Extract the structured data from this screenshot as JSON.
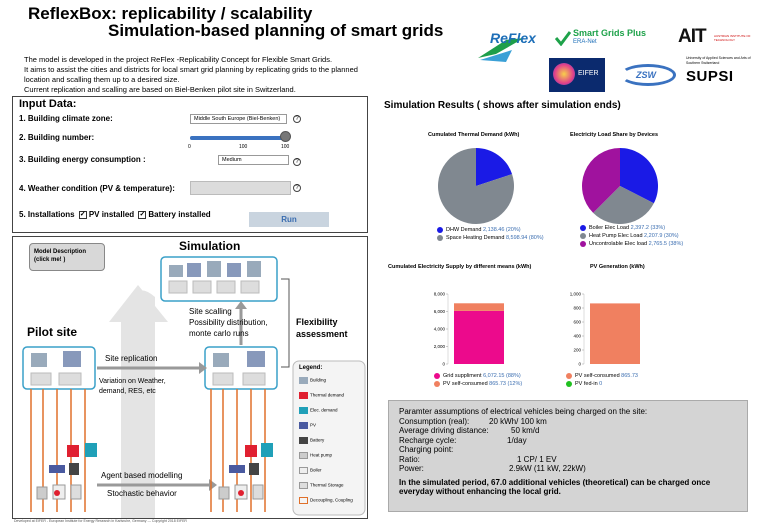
{
  "header": {
    "title": "ReflexBox: replicability / scalability",
    "subtitle": "Simulation-based planning of smart grids",
    "lines": [
      "The model is developed in the project ReFlex -Replicability Concept for Flexible Smart Grids.",
      "It aims to assist the cities and districts for local smart grid planning by replicating grids to the planned",
      "location and scalling them up to a desired size.",
      "Current replication and scalling are based on Biel-Benken pilot site in Switzerland."
    ],
    "logos": {
      "reflex": "ReFlex",
      "sgp_main": "Smart Grids Plus",
      "sgp_sub": "ERA-Net",
      "ait": "AIT",
      "ait_sub": "AUSTRIAN INSTITUTE OF TECHNOLOGY",
      "eifer": "EIFER",
      "zsw": "ZSW",
      "supsi_sub": "University of Applied Sciences and Arts of Southern Switzerland",
      "supsi": "SUPSI"
    }
  },
  "input": {
    "title": "Input Data:",
    "climate_label": "1. Building climate zone:",
    "climate_value": "Middle South Europe (Biel-Benken)",
    "number_label": "2. Building number:",
    "slider_ticks": [
      "0",
      "100",
      "100"
    ],
    "consumption_label": "3. Building energy consumption :",
    "consumption_value": "Medium",
    "weather_label": "4. Weather condition (PV & temperature):",
    "installations_label": "5. Installations",
    "pv_label": "PV installed",
    "battery_label": "Battery installed",
    "run_label": "Run",
    "help_symbol": "?",
    "check_symbol": "✓",
    "slider_level": 0.95
  },
  "diagram": {
    "model_button": "Model Description (click me! )",
    "simulation": "Simulation",
    "pilot_site": "Pilot site",
    "site_scalling": "Site scalling",
    "possibility": "Possibility distribution,",
    "montecarlo": "monte carlo runs",
    "flex1": "Flexibility",
    "flex2": "assessment",
    "site_replication": "Site replication",
    "variation1": "Variation on Weather,",
    "variation2": "demand, RES, etc",
    "agent": "Agent based modelling",
    "stochastic": "Stochastic behavior",
    "legend_title": "Legend:",
    "legend_items": [
      "Building",
      "Thermal demand",
      "Elec. demand",
      "PV",
      "Battery",
      "Heat pump",
      "Boiler",
      "Thermal Storage",
      "Decoupling, Coupling"
    ]
  },
  "results": {
    "title": "Simulation Results ( shows after simulation ends)",
    "thermal_title": "Cumulated Thermal Demand (kWh)",
    "thermal_legend": [
      {
        "name": "DHW Demand",
        "value": "2,138.46 (20%)",
        "color": "#1a1ae6"
      },
      {
        "name": "Space Heating Demand",
        "value": "8,598.94 (80%)",
        "color": "#808890"
      }
    ],
    "elec_title": "Electricity Load Share by Devices",
    "elec_legend": [
      {
        "name": "Boiler Elec Load",
        "value": "2,397.2 (33%)",
        "color": "#1a1ae6"
      },
      {
        "name": "Heat Pump Elec Load",
        "value": "2,207.9 (30%)",
        "color": "#808890"
      },
      {
        "name": "Uncontrolable Elec load",
        "value": "2,765.5 (38%)",
        "color": "#a0129e"
      }
    ],
    "supply_title": "Cumulated Electricity Supply by different means (kWh)",
    "supply_legend": [
      {
        "name": "Grid suppliment",
        "value": "6,072.15 (88%)",
        "color": "#ec0a8c"
      },
      {
        "name": "PV self-consumed",
        "value": "865.73 (12%)",
        "color": "#f08060"
      }
    ],
    "pv_title": "PV Generation (kWh)",
    "pv_legend": [
      {
        "name": "PV self-consumed",
        "value": "865.73",
        "color": "#f08060"
      },
      {
        "name": "PV fed-in",
        "value": "0",
        "color": "#20c020"
      }
    ]
  },
  "chart_data": [
    {
      "type": "pie",
      "title": "Cumulated Thermal Demand (kWh)",
      "labels": [
        "DHW Demand",
        "Space Heating Demand"
      ],
      "values": [
        2138.46,
        8598.94
      ],
      "colors": [
        "#1a1ae6",
        "#808890"
      ]
    },
    {
      "type": "pie",
      "title": "Electricity Load Share by Devices",
      "labels": [
        "Boiler Elec Load",
        "Heat Pump Elec Load",
        "Uncontrolable Elec load"
      ],
      "values": [
        2397.2,
        2207.9,
        2765.5
      ],
      "colors": [
        "#1a1ae6",
        "#808890",
        "#a0129e"
      ]
    },
    {
      "type": "bar",
      "title": "Cumulated Electricity Supply by different means (kWh)",
      "categories": [
        ""
      ],
      "series": [
        {
          "name": "Grid suppliment",
          "values": [
            6072.15
          ]
        },
        {
          "name": "PV self-consumed",
          "values": [
            865.73
          ]
        }
      ],
      "stacked": true,
      "ylim": [
        0,
        8000
      ],
      "yticks": [
        "0",
        "2,000",
        "4,000",
        "6,000",
        "8,000"
      ],
      "colors": [
        "#ec0a8c",
        "#f08060"
      ]
    },
    {
      "type": "bar",
      "title": "PV Generation (kWh)",
      "categories": [
        ""
      ],
      "series": [
        {
          "name": "PV self-consumed",
          "values": [
            865.73
          ]
        },
        {
          "name": "PV fed-in",
          "values": [
            0
          ]
        }
      ],
      "stacked": true,
      "ylim": [
        0,
        1000
      ],
      "yticks": [
        "0",
        "200",
        "400",
        "600",
        "800",
        "1,000"
      ],
      "colors": [
        "#f08060",
        "#20c020"
      ]
    }
  ],
  "ev": {
    "intro": "Paramter assumptions of electrical vehicles being charged on the site:",
    "rows": [
      {
        "k": "Consumption (real):",
        "v": "20 kWh/ 100 km"
      },
      {
        "k": "Average driving distance:",
        "v": "50 km/d"
      },
      {
        "k": "Recharge cycle:",
        "v": "1/day"
      },
      {
        "k": "Charging point:",
        "v": ""
      },
      {
        "k": "Ratio:",
        "v": "1 CP/ 1 EV"
      },
      {
        "k": "Power:",
        "v": "2.9kW (11 kW, 22kW)"
      }
    ],
    "conclusion": "In the simulated period, 67.0 additional vehicles (theoretical) can be charged once everyday without enhancing the local grid."
  },
  "footnote": "Developed at EIFER - European Institute for Energy Research in Karlsruhe, Germany --- Copyright 2018 EIFER"
}
